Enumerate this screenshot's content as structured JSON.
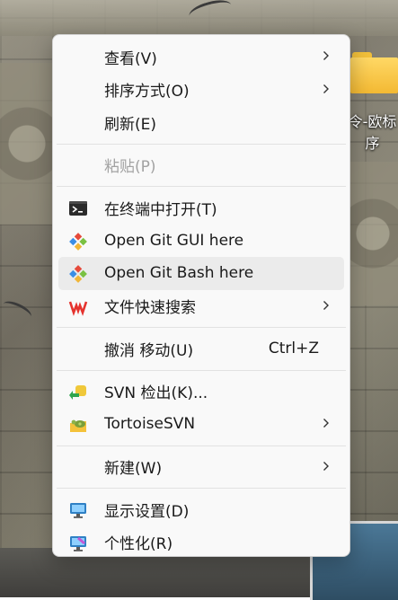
{
  "desktop": {
    "folder_label": "令-欧标\n序"
  },
  "menu": {
    "groups": [
      [
        {
          "label": "查看(V)",
          "submenu": true
        },
        {
          "label": "排序方式(O)",
          "submenu": true
        },
        {
          "label": "刷新(E)"
        }
      ],
      [
        {
          "label": "粘贴(P)",
          "disabled": true
        }
      ],
      [
        {
          "label": "在终端中打开(T)",
          "icon": "terminal-icon"
        },
        {
          "label": "Open Git GUI here",
          "icon": "git-gui-icon"
        },
        {
          "label": "Open Git Bash here",
          "icon": "git-bash-icon",
          "hovered": true
        },
        {
          "label": "文件快速搜索",
          "icon": "wps-icon",
          "submenu": true
        }
      ],
      [
        {
          "label": "撤消 移动(U)",
          "shortcut": "Ctrl+Z"
        }
      ],
      [
        {
          "label": "SVN 检出(K)...",
          "icon": "svn-checkout-icon"
        },
        {
          "label": "TortoiseSVN",
          "icon": "tortoisesvn-icon",
          "submenu": true
        }
      ],
      [
        {
          "label": "新建(W)",
          "submenu": true
        }
      ],
      [
        {
          "label": "显示设置(D)",
          "icon": "display-settings-icon"
        },
        {
          "label": "个性化(R)",
          "icon": "personalization-icon"
        }
      ]
    ]
  },
  "colors": {
    "menu_bg": "#f9f9f9",
    "hover_bg": "#ebebeb",
    "disabled_text": "#a3a3a3",
    "git_red": "#e64a3b",
    "git_green": "#7ac142",
    "git_blue": "#3a8ee6",
    "wps_red": "#e5322d"
  }
}
